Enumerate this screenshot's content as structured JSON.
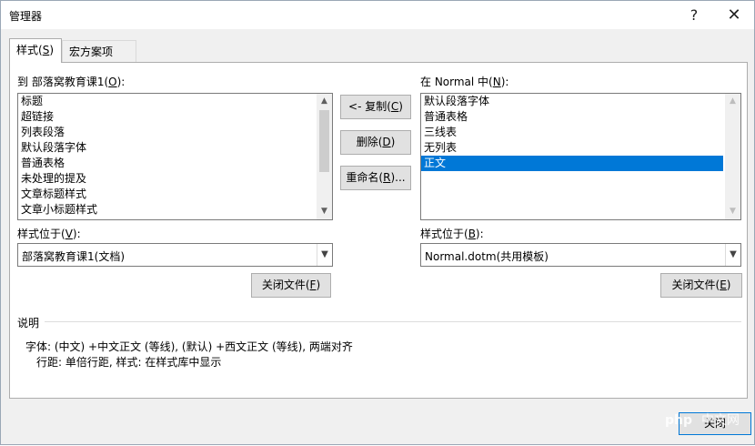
{
  "window": {
    "title": "管理器",
    "help_label": "?",
    "close_label": "✕"
  },
  "tabs": [
    {
      "label": "样式(",
      "key": "S",
      "tail": ")"
    },
    {
      "label": "宏方案项(",
      "key": "M",
      "tail": ")"
    }
  ],
  "left": {
    "list_label_pre": "到 部落窝教育课1(",
    "list_label_key": "O",
    "list_label_post": "):",
    "items": [
      "标题",
      "超链接",
      "列表段落",
      "默认段落字体",
      "普通表格",
      "未处理的提及",
      "文章标题样式",
      "文章小标题样式"
    ],
    "location_label_pre": "样式位于(",
    "location_label_key": "V",
    "location_label_post": "):",
    "location_value": "部落窝教育课1(文档)",
    "close_file_pre": "关闭文件(",
    "close_file_key": "F",
    "close_file_post": ")"
  },
  "middle": {
    "copy_pre": "<- 复制(",
    "copy_key": "C",
    "copy_post": ")",
    "delete_pre": "删除(",
    "delete_key": "D",
    "delete_post": ")",
    "rename_pre": "重命名(",
    "rename_key": "R",
    "rename_post": ")..."
  },
  "right": {
    "list_label_pre": "在 Normal 中(",
    "list_label_key": "N",
    "list_label_post": "):",
    "items": [
      "默认段落字体",
      "普通表格",
      "三线表",
      "无列表",
      "正文"
    ],
    "selected_index": 4,
    "location_label_pre": "样式位于(",
    "location_label_key": "B",
    "location_label_post": "):",
    "location_value": "Normal.dotm(共用模板)",
    "close_file_pre": "关闭文件(",
    "close_file_key": "E",
    "close_file_post": ")"
  },
  "description": {
    "heading": "说明",
    "line1": "字体: (中文) +中文正文 (等线), (默认) +西文正文 (等线), 两端对齐",
    "line2": "行距: 单倍行距, 样式: 在样式库中显示"
  },
  "footer": {
    "close_label": "关闭",
    "watermark_text": "php 中文网"
  },
  "colors": {
    "selection": "#0078d7",
    "dialog_bg": "#f0f0f0",
    "button_bg": "#e1e1e1"
  }
}
